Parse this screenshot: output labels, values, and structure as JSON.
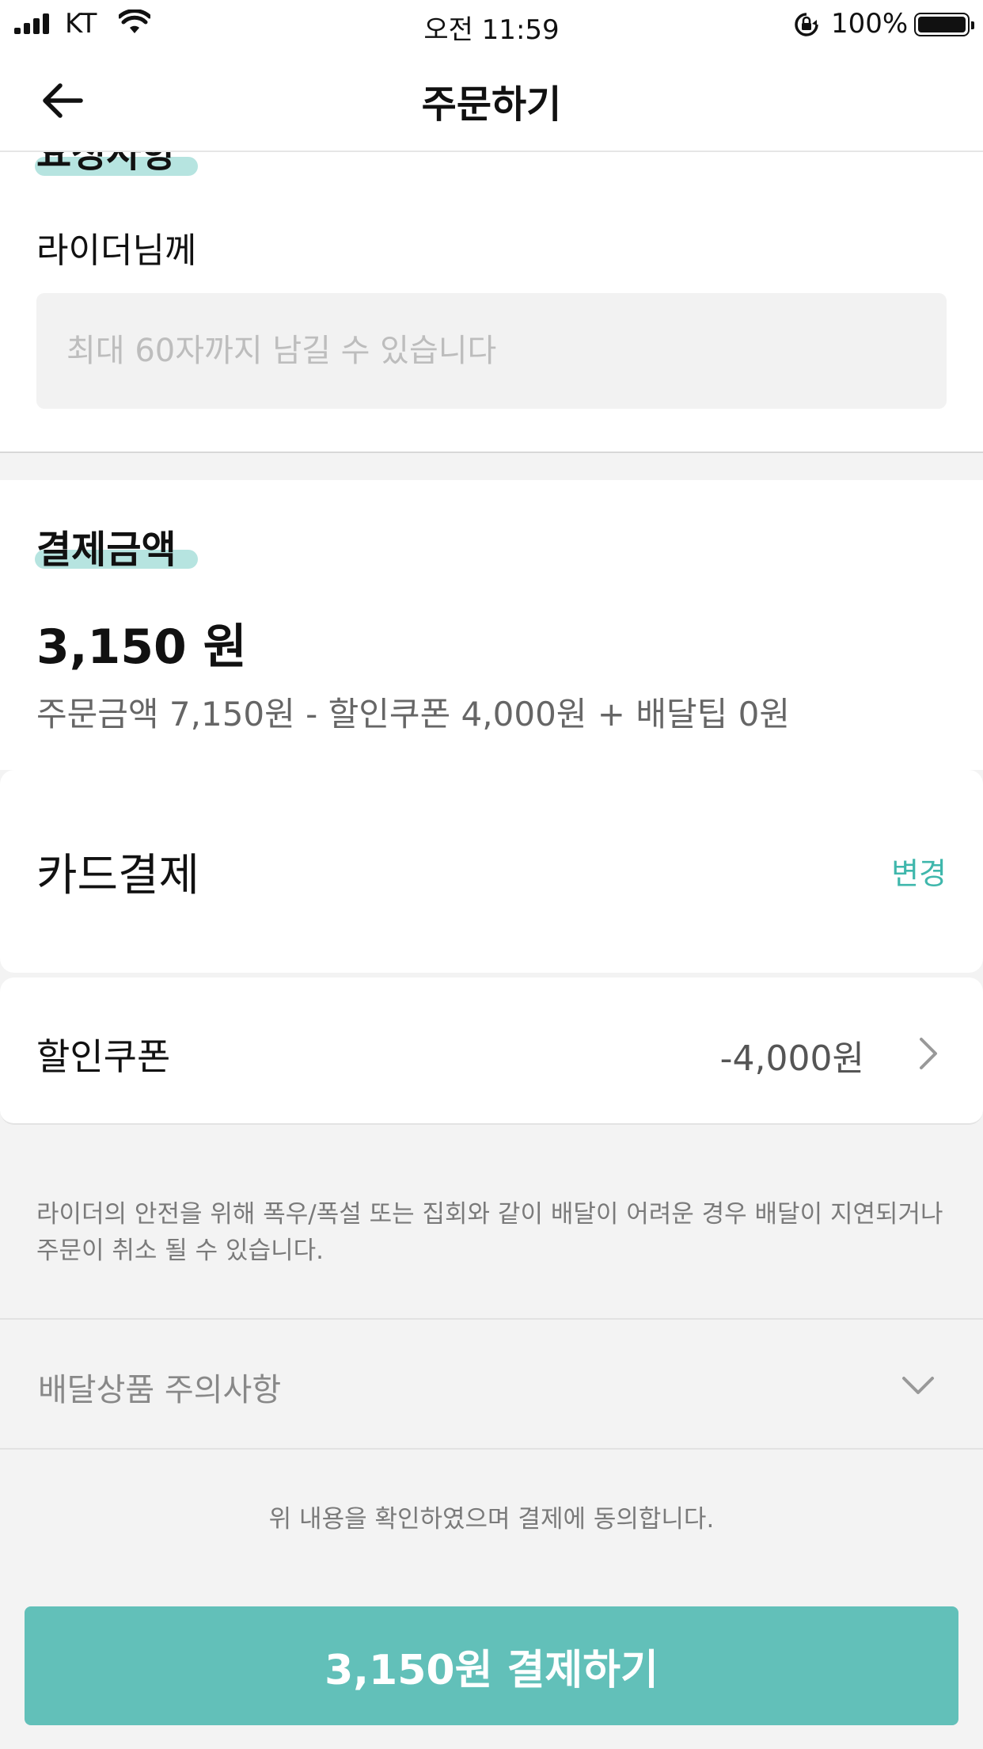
{
  "status_bar": {
    "carrier": "KT",
    "time": "오전 11:59",
    "battery": "100%"
  },
  "header": {
    "title": "주문하기"
  },
  "request": {
    "cut_title": "요청사항",
    "rider_label": "라이더님께",
    "placeholder": "최대 60자까지 남길 수 있습니다"
  },
  "payment": {
    "title": "결제금액",
    "amount": "3,150 원",
    "breakdown": "주문금액 7,150원 - 할인쿠폰 4,000원 + 배달팁 0원"
  },
  "method": {
    "label": "카드결제",
    "change": "변경"
  },
  "coupon": {
    "label": "할인쿠폰",
    "value": "-4,000원"
  },
  "notice": {
    "line1": "라이더의 안전을 위해 폭우/폭설 또는 집회와 같이 배달이 어려운 경우 배달이 지연되거나",
    "line2": "주문이 취소 될 수 있습니다."
  },
  "caution": {
    "label": "배달상품 주의사항"
  },
  "agree": {
    "text": "위 내용을 확인하였으며 결제에 동의합니다."
  },
  "pay_button": {
    "label": "3,150원 결제하기"
  },
  "colors": {
    "accent": "#62c0b9",
    "accent_text": "#3fb7ac",
    "highlight": "#b6e4e0"
  }
}
